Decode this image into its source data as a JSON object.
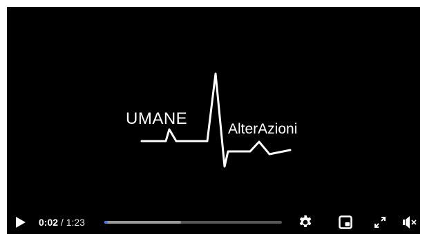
{
  "video": {
    "logo": {
      "word_left": "UMANE",
      "word_right": "AlterAzioni"
    }
  },
  "controls": {
    "play_icon": "play-icon",
    "current_time": "0:02",
    "separator": " / ",
    "duration": "1:23",
    "progress": {
      "played_fraction": 0.02,
      "buffered_fraction": 0.43
    },
    "icons": [
      "gear-icon",
      "picture-in-picture-icon",
      "fullscreen-icon",
      "muted-speaker-icon"
    ]
  },
  "colors": {
    "background": "#000000",
    "accent": "#3d7bf5",
    "foreground": "#ffffff"
  }
}
